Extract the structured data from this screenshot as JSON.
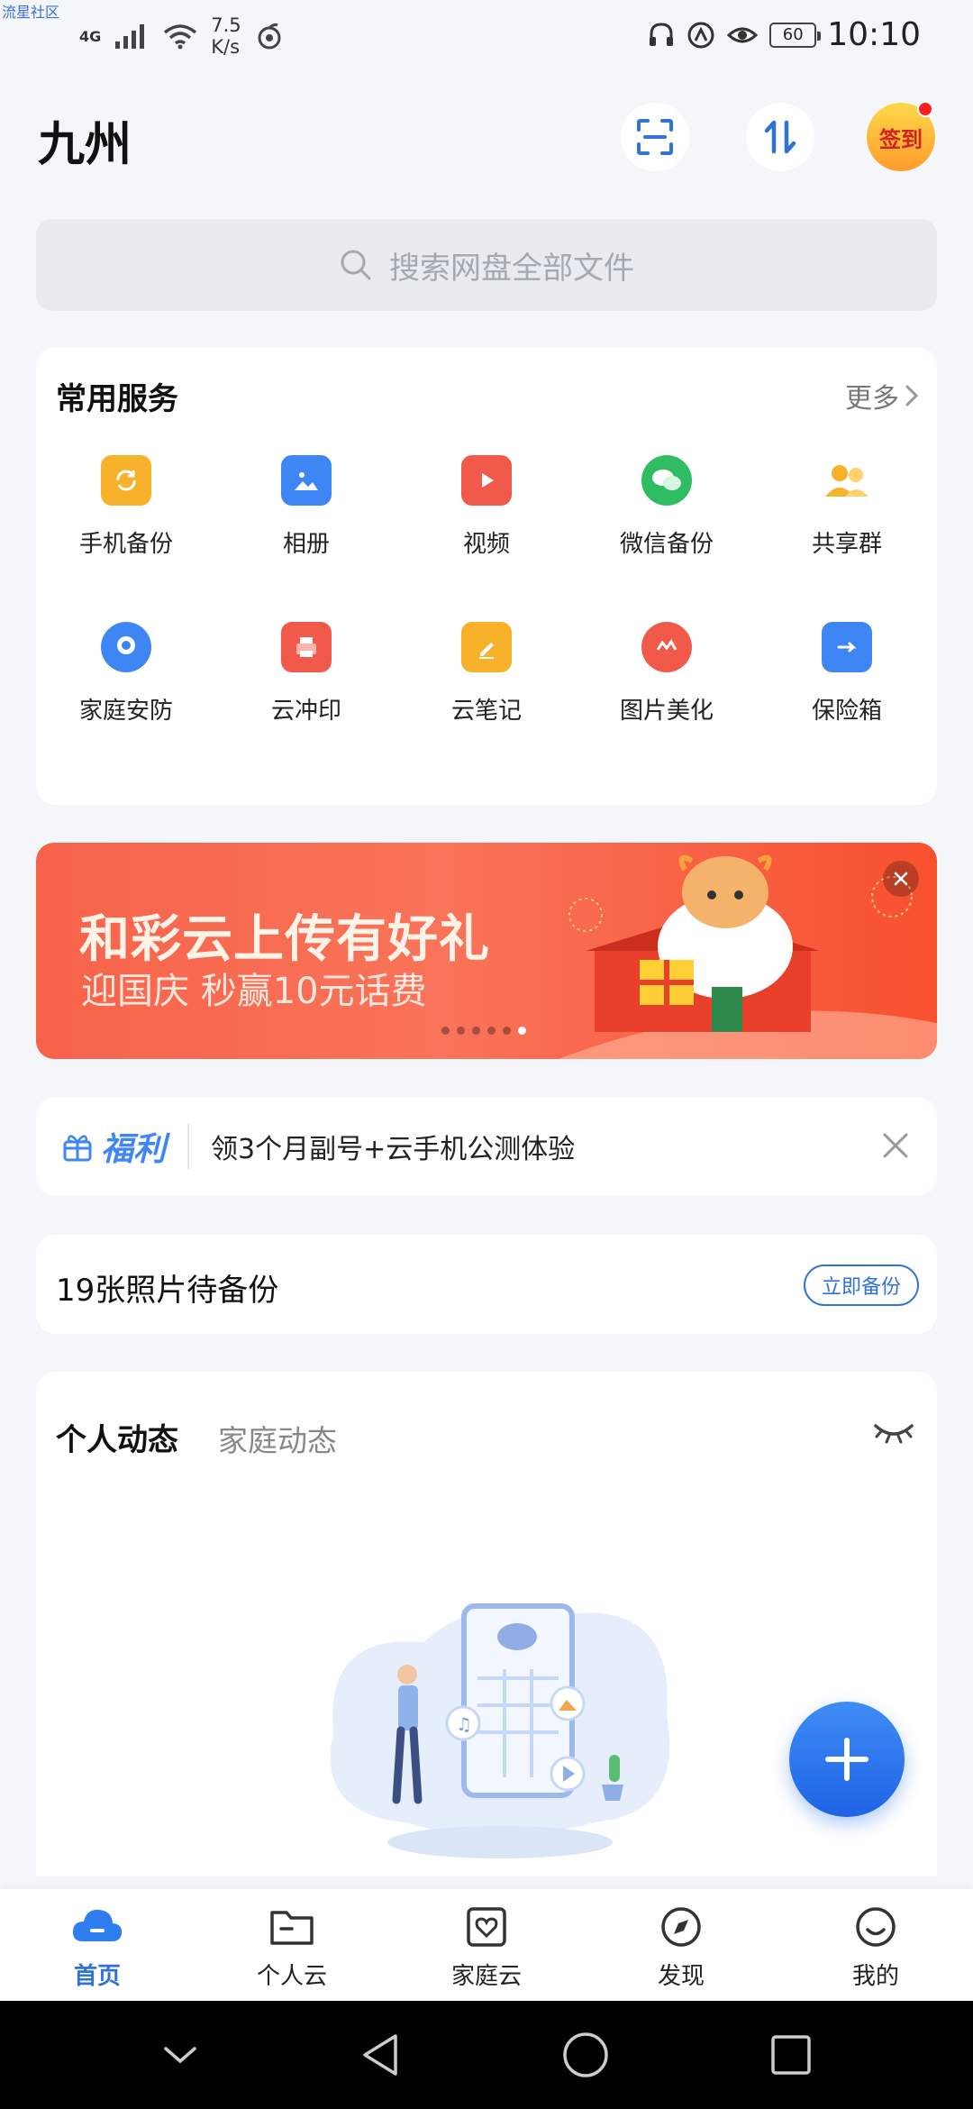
{
  "watermark": "流星社区",
  "status_bar": {
    "network": "4G",
    "speed_value": "7.5",
    "speed_unit": "K/s",
    "battery": "60",
    "time": "10:10"
  },
  "header": {
    "title": "九州",
    "signin_label": "签到"
  },
  "search": {
    "placeholder": "搜索网盘全部文件"
  },
  "services": {
    "title": "常用服务",
    "more": "更多",
    "items": [
      {
        "label": "手机备份",
        "icon": "phone-backup-icon",
        "color": "#f7b12b"
      },
      {
        "label": "相册",
        "icon": "album-icon",
        "color": "#3d86f3"
      },
      {
        "label": "视频",
        "icon": "video-icon",
        "color": "#f15a4a"
      },
      {
        "label": "微信备份",
        "icon": "wechat-icon",
        "color": "#2ebd62"
      },
      {
        "label": "共享群",
        "icon": "share-group-icon",
        "color": "#f7b12b"
      },
      {
        "label": "家庭安防",
        "icon": "camera-icon",
        "color": "#3d86f3"
      },
      {
        "label": "云冲印",
        "icon": "printer-icon",
        "color": "#f15a4a"
      },
      {
        "label": "云笔记",
        "icon": "note-icon",
        "color": "#f7b12b"
      },
      {
        "label": "图片美化",
        "icon": "beautify-icon",
        "color": "#f15a4a"
      },
      {
        "label": "保险箱",
        "icon": "safe-icon",
        "color": "#3d86f3"
      }
    ]
  },
  "banner": {
    "title": "和彩云上传有好礼",
    "subtitle": "迎国庆 秒赢10元话费",
    "slide_count": 6,
    "active_slide": 6
  },
  "promo": {
    "tag": "福利",
    "text": "领3个月副号+云手机公测体验"
  },
  "backup": {
    "text": "19张照片待备份",
    "button": "立即备份"
  },
  "activity": {
    "tabs": [
      "个人动态",
      "家庭动态"
    ]
  },
  "bottom_nav": [
    {
      "label": "首页",
      "icon": "cloud-home-icon",
      "active": true
    },
    {
      "label": "个人云",
      "icon": "folder-icon",
      "active": false
    },
    {
      "label": "家庭云",
      "icon": "family-heart-icon",
      "active": false
    },
    {
      "label": "发现",
      "icon": "compass-icon",
      "active": false
    },
    {
      "label": "我的",
      "icon": "smile-icon",
      "active": false
    }
  ],
  "colors": {
    "accent": "#2f73d9",
    "background": "#f4f6fa",
    "banner": "#f7634a",
    "fab": "#2a73ee"
  }
}
